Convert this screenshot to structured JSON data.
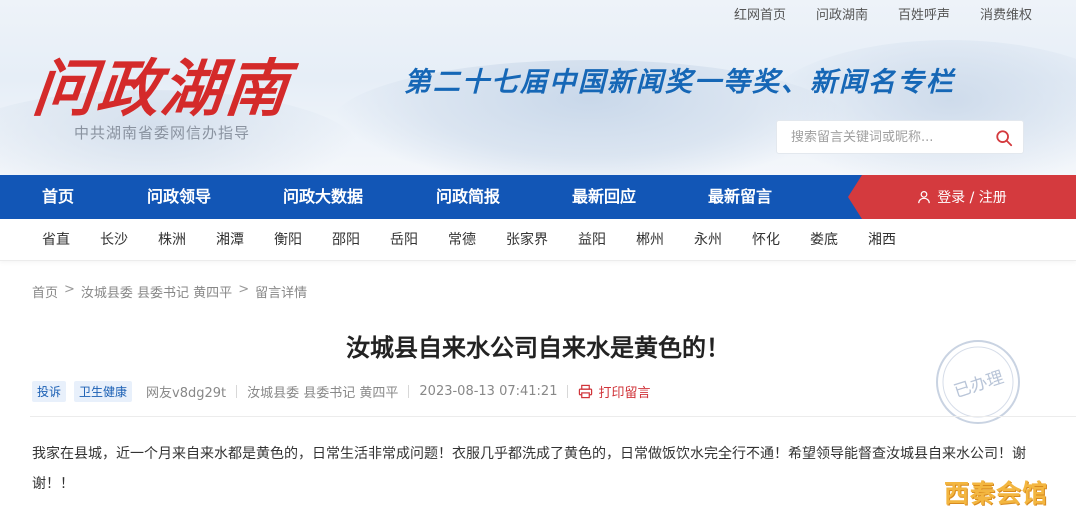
{
  "top_links": [
    "红网首页",
    "问政湖南",
    "百姓呼声",
    "消费维权"
  ],
  "logo": {
    "text": "问政湖南",
    "subtitle": "中共湖南省委网信办指导"
  },
  "slogan": "第二十七届中国新闻奖一等奖、新闻名专栏",
  "search": {
    "placeholder": "搜索留言关键词或昵称..."
  },
  "nav": {
    "items": [
      "首页",
      "问政领导",
      "问政大数据",
      "问政简报",
      "最新回应",
      "最新留言"
    ],
    "login_label": "登录 / 注册"
  },
  "cities": [
    "省直",
    "长沙",
    "株洲",
    "湘潭",
    "衡阳",
    "邵阳",
    "岳阳",
    "常德",
    "张家界",
    "益阳",
    "郴州",
    "永州",
    "怀化",
    "娄底",
    "湘西"
  ],
  "breadcrumb": [
    "首页",
    "汝城县委 县委书记 黄四平",
    "留言详情"
  ],
  "post": {
    "title": "汝城县自来水公司自来水是黄色的！",
    "tags": [
      "投诉",
      "卫生健康"
    ],
    "author": "网友v8dg29t",
    "recipient": "汝城县委 县委书记 黄四平",
    "time": "2023-08-13 07:41:21",
    "print_label": "打印留言",
    "status_stamp": "已办理",
    "content": "我家在县城，近一个月来自来水都是黄色的，日常生活非常成问题！衣服几乎都洗成了黄色的，日常做饭饮水完全行不通！希望领导能督查汝城县自来水公司！谢谢！！"
  },
  "watermark": "西秦会馆",
  "colors": {
    "nav_blue": "#1256b6",
    "login_red": "#d43a3e",
    "logo_red": "#d42a2a",
    "slogan_blue": "#1667b6"
  }
}
